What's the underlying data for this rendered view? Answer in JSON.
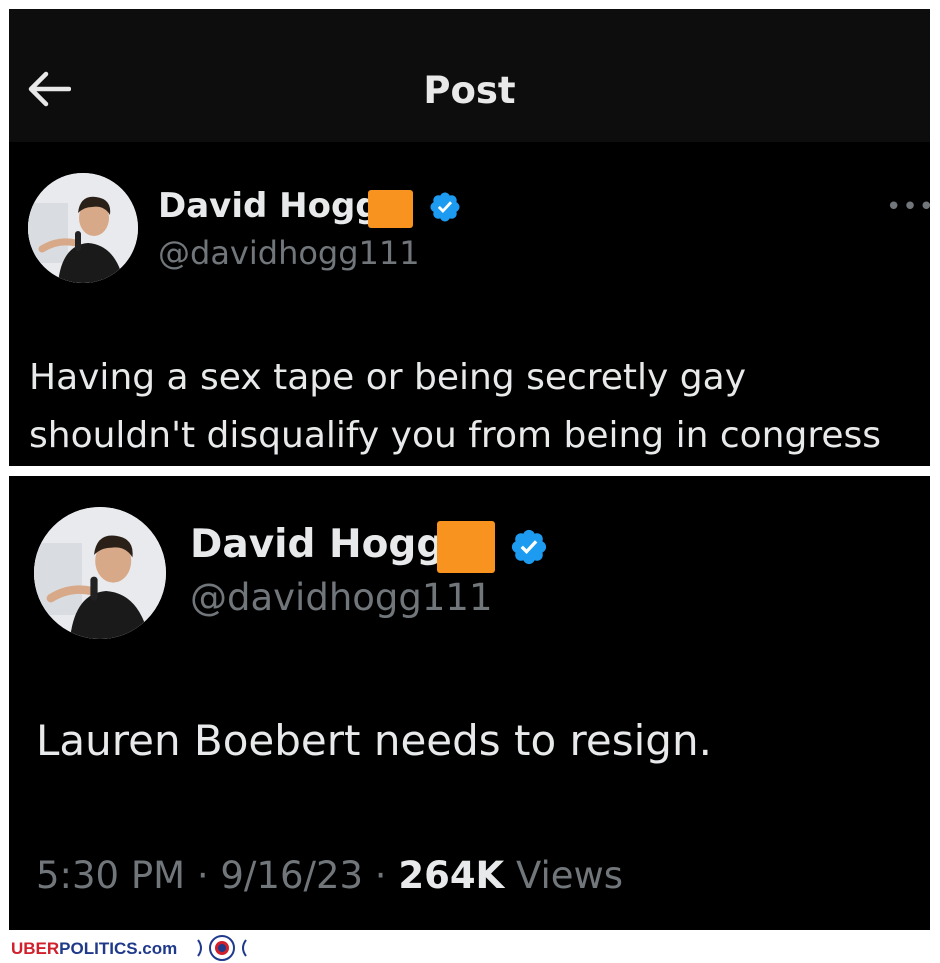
{
  "header": {
    "title": "Post",
    "back_icon": "back-arrow-icon"
  },
  "tweet1": {
    "display_name": "David Hogg",
    "handle": "@davidhogg111",
    "more_label": "•••",
    "text_line1": "Having a sex tape or being secretly gay",
    "text_line2": "shouldn't disqualify you from being in congress"
  },
  "tweet2": {
    "display_name": "David Hogg",
    "handle": "@davidhogg111",
    "text": "Lauren Boebert needs to resign.",
    "time": "5:30 PM",
    "date": "9/16/23",
    "views_count": "264K",
    "views_label": "Views",
    "separator": "·"
  },
  "footer": {
    "brand_part1": "UBER",
    "brand_part2": "POLITICS.com"
  },
  "colors": {
    "background": "#000000",
    "primary_text": "#e7e9ea",
    "secondary_text": "#71767b",
    "verified_blue": "#1d9bf0",
    "orange_badge": "#f7931e"
  }
}
